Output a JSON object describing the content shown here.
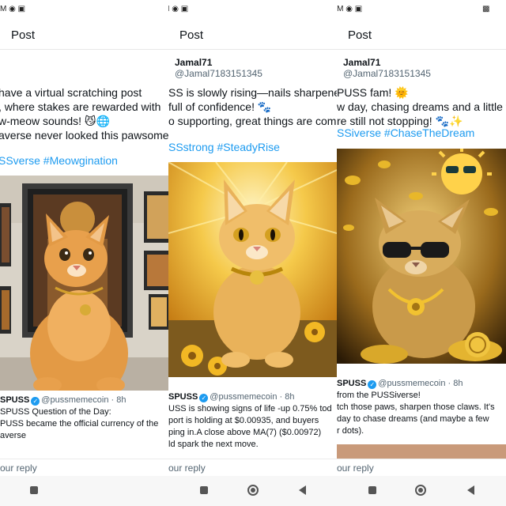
{
  "status_bar": {
    "panel_1_left": "M",
    "panel_2_left": "M",
    "panel_3_left": "M"
  },
  "panels": [
    {
      "header_title": "Post",
      "author_name": "",
      "author_handle": "",
      "body_lines": [
        "have a virtual scratching post",
        ", where stakes are rewarded with",
        "w-meow sounds! 😼🌐",
        "averse never looked this pawsome!"
      ],
      "hashtags": "SSverse #Meowgination",
      "quote": {
        "name": "SPUSS",
        "handle": "@pussmemecoin",
        "time": "· 8h",
        "lines": [
          "SPUSS Question of the Day:",
          "PUSS became the official currency of the",
          "averse"
        ]
      },
      "reply_placeholder": "our reply"
    },
    {
      "header_title": "Post",
      "author_name": "Jamal71",
      "author_handle": "@Jamal7183151345",
      "body_lines": [
        "SS is slowly rising—nails sharpened",
        "full of confidence! 🐾",
        "o supporting, great things are comin"
      ],
      "hashtags": "SSstrong #SteadyRise",
      "quote": {
        "name": "SPUSS",
        "handle": "@pussmemecoin",
        "time": "· 8h",
        "lines": [
          "USS is showing signs of life -up 0.75% tod",
          "port is holding at $0.00935, and buyers",
          "ping in.A close above MA(7) ($0.00972)",
          "ld spark the next move."
        ]
      },
      "reply_placeholder": "our reply"
    },
    {
      "header_title": "Post",
      "author_name": "Jamal71",
      "author_handle": "@Jamal7183151345",
      "body_lines": [
        "PUSS fam! 🌞",
        "w day, chasing dreams and a little f",
        "re still not stopping! 🐾✨"
      ],
      "hashtags": "SSiverse #ChaseTheDream",
      "quote": {
        "name": "SPUSS",
        "handle": "@pussmemecoin",
        "time": "· 8h",
        "lines": [
          "from the PUSSiverse!",
          "tch those paws, sharpen those claws. It's",
          "day to chase dreams (and maybe a few",
          "r dots)."
        ]
      },
      "reply_placeholder": "our reply"
    }
  ],
  "colors": {
    "accent": "#1d9bf0",
    "text": "#0f1419",
    "muted": "#536471"
  },
  "icons": {
    "nav_recents": "square-icon",
    "nav_home": "circle-home-icon",
    "nav_back": "triangle-back-icon",
    "verified": "verified-badge-icon"
  }
}
